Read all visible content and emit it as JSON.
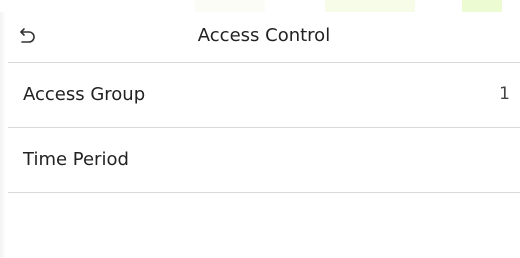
{
  "header": {
    "title": "Access Control",
    "back_icon": "back-arrow-icon"
  },
  "menu": {
    "items": [
      {
        "label": "Access Group",
        "value": "1"
      },
      {
        "label": "Time Period",
        "value": ""
      }
    ]
  },
  "colors": {
    "background": "#ffffff",
    "divider": "#d9d9d9",
    "text": "#222222"
  }
}
